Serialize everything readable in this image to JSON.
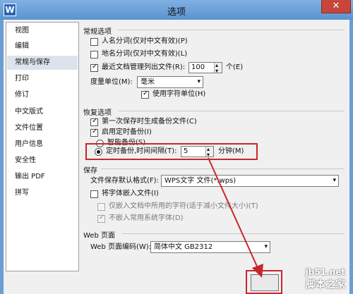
{
  "window": {
    "title": "选项",
    "app_icon": "W",
    "close_glyph": "✕"
  },
  "nav": {
    "items": [
      "视图",
      "编辑",
      "常规与保存",
      "打印",
      "修订",
      "中文版式",
      "文件位置",
      "用户信息",
      "安全性",
      "输出 PDF",
      "拼写"
    ],
    "selected": "常规与保存"
  },
  "general": {
    "title": "常规选项",
    "name_segment": "人名分词(仅对中文有效)(P)",
    "place_segment": "地名分词(仅对中文有效)(L)",
    "recent_files_label": "最近文档管理列出文件(R):",
    "recent_files_value": "100",
    "recent_files_unit": "个(E)",
    "unit_label": "度量单位(M):",
    "unit_value": "毫米",
    "char_unit": "使用字符单位(H)"
  },
  "recovery": {
    "title": "恢复选项",
    "backup_first_save": "第一次保存时生成备份文件(C)",
    "enable_timed_backup": "启用定时备份(I)",
    "smart_backup": "智能备份(S)",
    "timed_backup_label": "定时备份,时间间隔(T):",
    "interval_value": "5",
    "interval_unit": "分钟(M)"
  },
  "save": {
    "title": "保存",
    "default_format_label": "文件保存默认格式(F):",
    "default_format_value": "WPS文字 文件(*.wps)",
    "embed_fonts": "将字体嵌入文件(I)",
    "embed_used_only": "仅嵌入文档中所用的字符(适于减小文件大小)(T)",
    "no_common_fonts": "不嵌入常用系统字体(D)"
  },
  "web": {
    "title": "Web 页面",
    "encoding_label": "Web 页面编码(W):",
    "encoding_value": "简体中文 GB2312"
  },
  "watermark": {
    "line1": "jb51.net",
    "line2": "脚本之家"
  },
  "colors": {
    "highlight_red": "#c8262c",
    "selection": "#dde3ec",
    "title_blue": "#6a9ed4"
  }
}
